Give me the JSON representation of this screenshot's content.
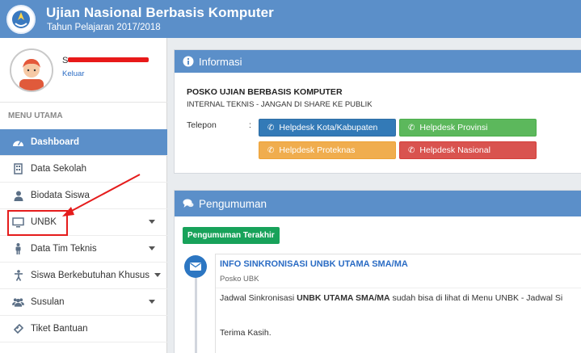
{
  "header": {
    "title": "Ujian Nasional Berbasis Komputer",
    "subtitle": "Tahun Pelajaran 2017/2018"
  },
  "profile": {
    "name_visible": "S",
    "logout": "Keluar"
  },
  "sidebar": {
    "heading": "MENU UTAMA",
    "items": [
      {
        "label": "Dashboard",
        "icon": "dashboard-icon",
        "active": true
      },
      {
        "label": "Data Sekolah",
        "icon": "building-icon"
      },
      {
        "label": "Biodata Siswa",
        "icon": "user-icon"
      },
      {
        "label": "UNBK",
        "icon": "monitor-icon",
        "has_submenu": true
      },
      {
        "label": "Data Tim Teknis",
        "icon": "person-icon",
        "has_submenu": true
      },
      {
        "label": "Siswa Berkebutuhan Khusus",
        "icon": "accessibility-icon",
        "has_submenu": true
      },
      {
        "label": "Susulan",
        "icon": "users-icon",
        "has_submenu": true
      },
      {
        "label": "Tiket Bantuan",
        "icon": "ticket-icon"
      }
    ]
  },
  "info": {
    "title": "Informasi",
    "posko": "POSKO UJIAN BERBASIS KOMPUTER",
    "internal": "INTERNAL TEKNIS - JANGAN DI SHARE KE PUBLIK",
    "telepon_label": "Telepon",
    "colon": ":",
    "buttons": {
      "kota": "Helpdesk Kota/Kabupaten",
      "provinsi": "Helpdesk Provinsi",
      "proteknas": "Helpdesk Proteknas",
      "nasional": "Helpdesk Nasional"
    }
  },
  "announcement": {
    "title": "Pengumuman",
    "tag": "Pengumuman Terakhir",
    "item_title": "INFO SINKRONISASI UNBK UTAMA SMA/MA",
    "item_author": "Posko UBK",
    "body_prefix": "Jadwal Sinkronisasi ",
    "body_bold": "UNBK UTAMA SMA/MA",
    "body_suffix": " sudah bisa di lihat di Menu UNBK - Jadwal Si",
    "thanks": "Terima Kasih."
  },
  "colors": {
    "header": "#5b8fc9",
    "active_menu": "#5b8fc9",
    "annotation": "#e51c1c"
  }
}
